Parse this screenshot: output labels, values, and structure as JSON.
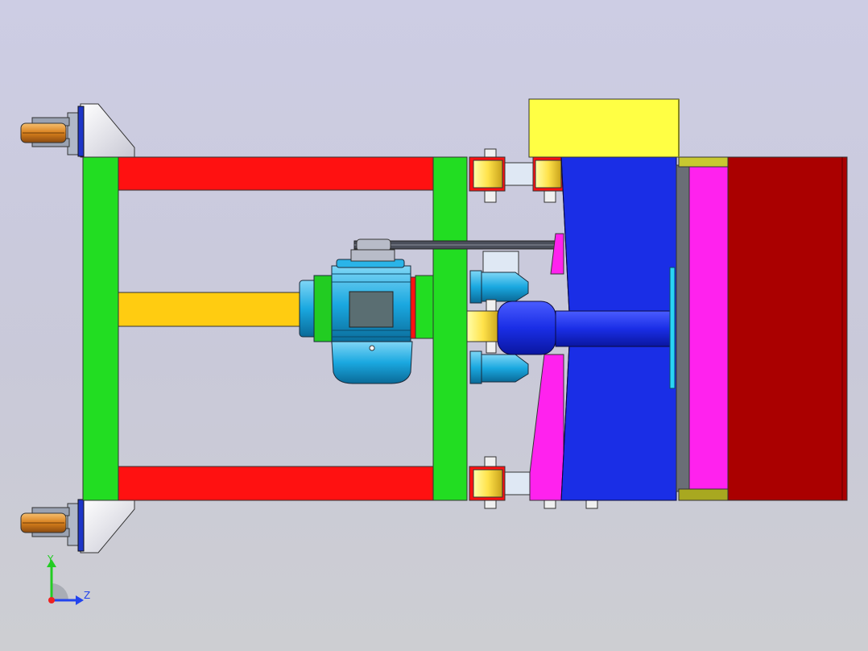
{
  "triad": {
    "y_label": "Y",
    "z_label": "Z"
  },
  "colors": {
    "background_top": "#cdcde4",
    "background_bottom": "#cdced2",
    "frame_green": "#22dd22",
    "rail_red": "#ff1111",
    "beam_yellow": "#ffcc11",
    "motor_cyan": "#1aa8e0",
    "impeller_blue": "#1a2ee6",
    "panel_magenta": "#ff22ee",
    "box_darkred": "#aa0000",
    "hopper_yellow": "#ffff44",
    "caster_orange": "#e08a20",
    "axis_y": "#22cc22",
    "axis_z": "#2244ee",
    "axis_x": "#ee2222"
  }
}
